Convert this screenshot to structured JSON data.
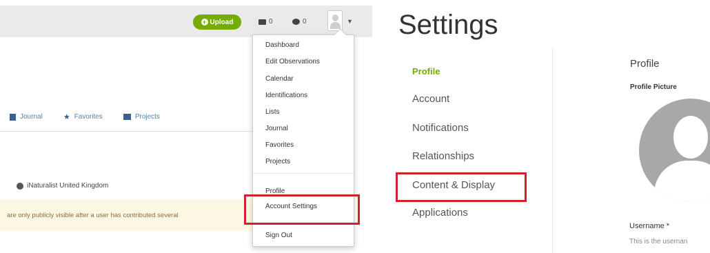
{
  "header": {
    "upload_label": "Upload",
    "messages_count": "0",
    "comments_count": "0"
  },
  "profile_tabs": [
    {
      "label": "Journal",
      "icon": "journal-icon"
    },
    {
      "label": "Favorites",
      "icon": "star-icon"
    },
    {
      "label": "Projects",
      "icon": "briefcase-icon"
    }
  ],
  "location_label": "iNaturalist United Kingdom",
  "notice_text": "are only publicly visible after a user has contributed several",
  "user_menu": {
    "items": [
      "Dashboard",
      "Edit Observations",
      "Calendar",
      "Identifications",
      "Lists",
      "Journal",
      "Favorites",
      "Projects"
    ],
    "profile_label": "Profile",
    "account_settings_label": "Account Settings",
    "sign_out_label": "Sign Out"
  },
  "settings": {
    "title": "Settings",
    "nav": [
      "Profile",
      "Account",
      "Notifications",
      "Relationships",
      "Content & Display",
      "Applications"
    ],
    "active": "Profile",
    "profile_heading": "Profile",
    "profile_picture_label": "Profile Picture",
    "username_label": "Username *",
    "username_help": "This is the usernan"
  },
  "colors": {
    "brand_green": "#74ac00",
    "highlight_red": "#d0212f",
    "notice_bg": "#fcf8e3"
  }
}
